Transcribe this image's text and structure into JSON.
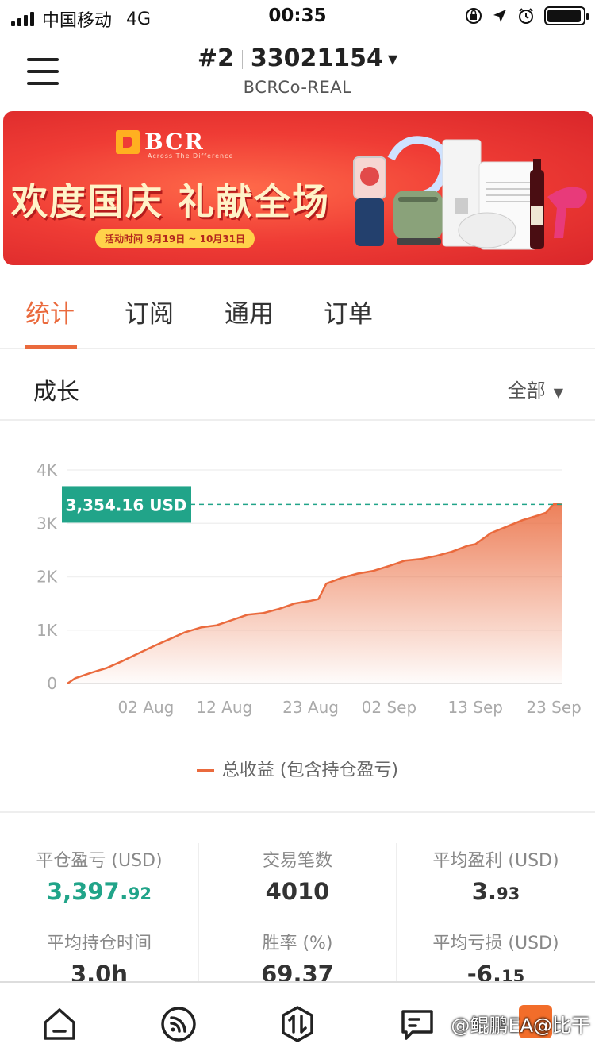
{
  "status_bar": {
    "carrier": "中国移动",
    "network": "4G",
    "time": "00:35",
    "battery_level": 0.95
  },
  "header": {
    "account_index": "#2",
    "account_number": "33021154",
    "server": "BCRCo-REAL"
  },
  "banner": {
    "logo_text": "BCR",
    "logo_tagline": "Across The Difference",
    "slogan": "欢度国庆 礼献全场",
    "date_text": "活动时间 9月19日 ~ 10月31日"
  },
  "tabs": [
    {
      "label": "统计",
      "active": true
    },
    {
      "label": "订阅",
      "active": false
    },
    {
      "label": "通用",
      "active": false
    },
    {
      "label": "订单",
      "active": false
    }
  ],
  "growth": {
    "title": "成长",
    "filter": "全部"
  },
  "chart_data": {
    "type": "area",
    "title": "",
    "xlabel": "",
    "ylabel": "",
    "y_ticks": [
      "0",
      "1K",
      "2K",
      "3K",
      "4K"
    ],
    "x_ticks": [
      "02 Aug",
      "12 Aug",
      "23 Aug",
      "02 Sep",
      "13 Sep",
      "23 Sep"
    ],
    "ylim": [
      0,
      4000
    ],
    "grid": true,
    "legend_position": "bottom",
    "current_label": "3,354.16 USD",
    "current_value": 3354.16,
    "series": [
      {
        "name": "总收益 (包含持仓盈亏)",
        "color": "#ea6a3d",
        "points": [
          [
            "2019-07-23",
            0
          ],
          [
            "2019-07-24",
            100
          ],
          [
            "2019-07-26",
            200
          ],
          [
            "2019-07-28",
            290
          ],
          [
            "2019-07-30",
            420
          ],
          [
            "2019-08-01",
            560
          ],
          [
            "2019-08-03",
            700
          ],
          [
            "2019-08-05",
            830
          ],
          [
            "2019-08-07",
            960
          ],
          [
            "2019-08-09",
            1050
          ],
          [
            "2019-08-11",
            1090
          ],
          [
            "2019-08-13",
            1190
          ],
          [
            "2019-08-15",
            1290
          ],
          [
            "2019-08-17",
            1320
          ],
          [
            "2019-08-19",
            1400
          ],
          [
            "2019-08-21",
            1500
          ],
          [
            "2019-08-23",
            1550
          ],
          [
            "2019-08-24",
            1580
          ],
          [
            "2019-08-25",
            1870
          ],
          [
            "2019-08-27",
            1980
          ],
          [
            "2019-08-29",
            2060
          ],
          [
            "2019-08-31",
            2110
          ],
          [
            "2019-09-02",
            2200
          ],
          [
            "2019-09-04",
            2300
          ],
          [
            "2019-09-06",
            2330
          ],
          [
            "2019-09-08",
            2390
          ],
          [
            "2019-09-10",
            2470
          ],
          [
            "2019-09-12",
            2580
          ],
          [
            "2019-09-13",
            2610
          ],
          [
            "2019-09-15",
            2820
          ],
          [
            "2019-09-17",
            2940
          ],
          [
            "2019-09-19",
            3060
          ],
          [
            "2019-09-21",
            3150
          ],
          [
            "2019-09-22",
            3200
          ],
          [
            "2019-09-23",
            3360
          ],
          [
            "2019-09-24",
            3354.16
          ]
        ]
      }
    ]
  },
  "stats": [
    {
      "label": "平仓盈亏 (USD)",
      "value_main": "3,397.",
      "value_small": "92",
      "color": "#21a489"
    },
    {
      "label": "交易笔数",
      "value_main": "4010",
      "value_small": ""
    },
    {
      "label": "平均盈利 (USD)",
      "value_main": "3.",
      "value_small": "93"
    },
    {
      "label": "平均持仓时间",
      "value_main": "3.0h",
      "value_small": ""
    },
    {
      "label": "胜率 (%)",
      "value_main": "69.37",
      "value_small": ""
    },
    {
      "label": "平均亏损 (USD)",
      "value_main": "-6.",
      "value_small": "15"
    }
  ],
  "bottom_nav": [
    {
      "icon": "home-icon"
    },
    {
      "icon": "signal-icon"
    },
    {
      "icon": "trade-icon"
    },
    {
      "icon": "chat-icon"
    }
  ],
  "watermark": "@鲲鹏EA@比干"
}
